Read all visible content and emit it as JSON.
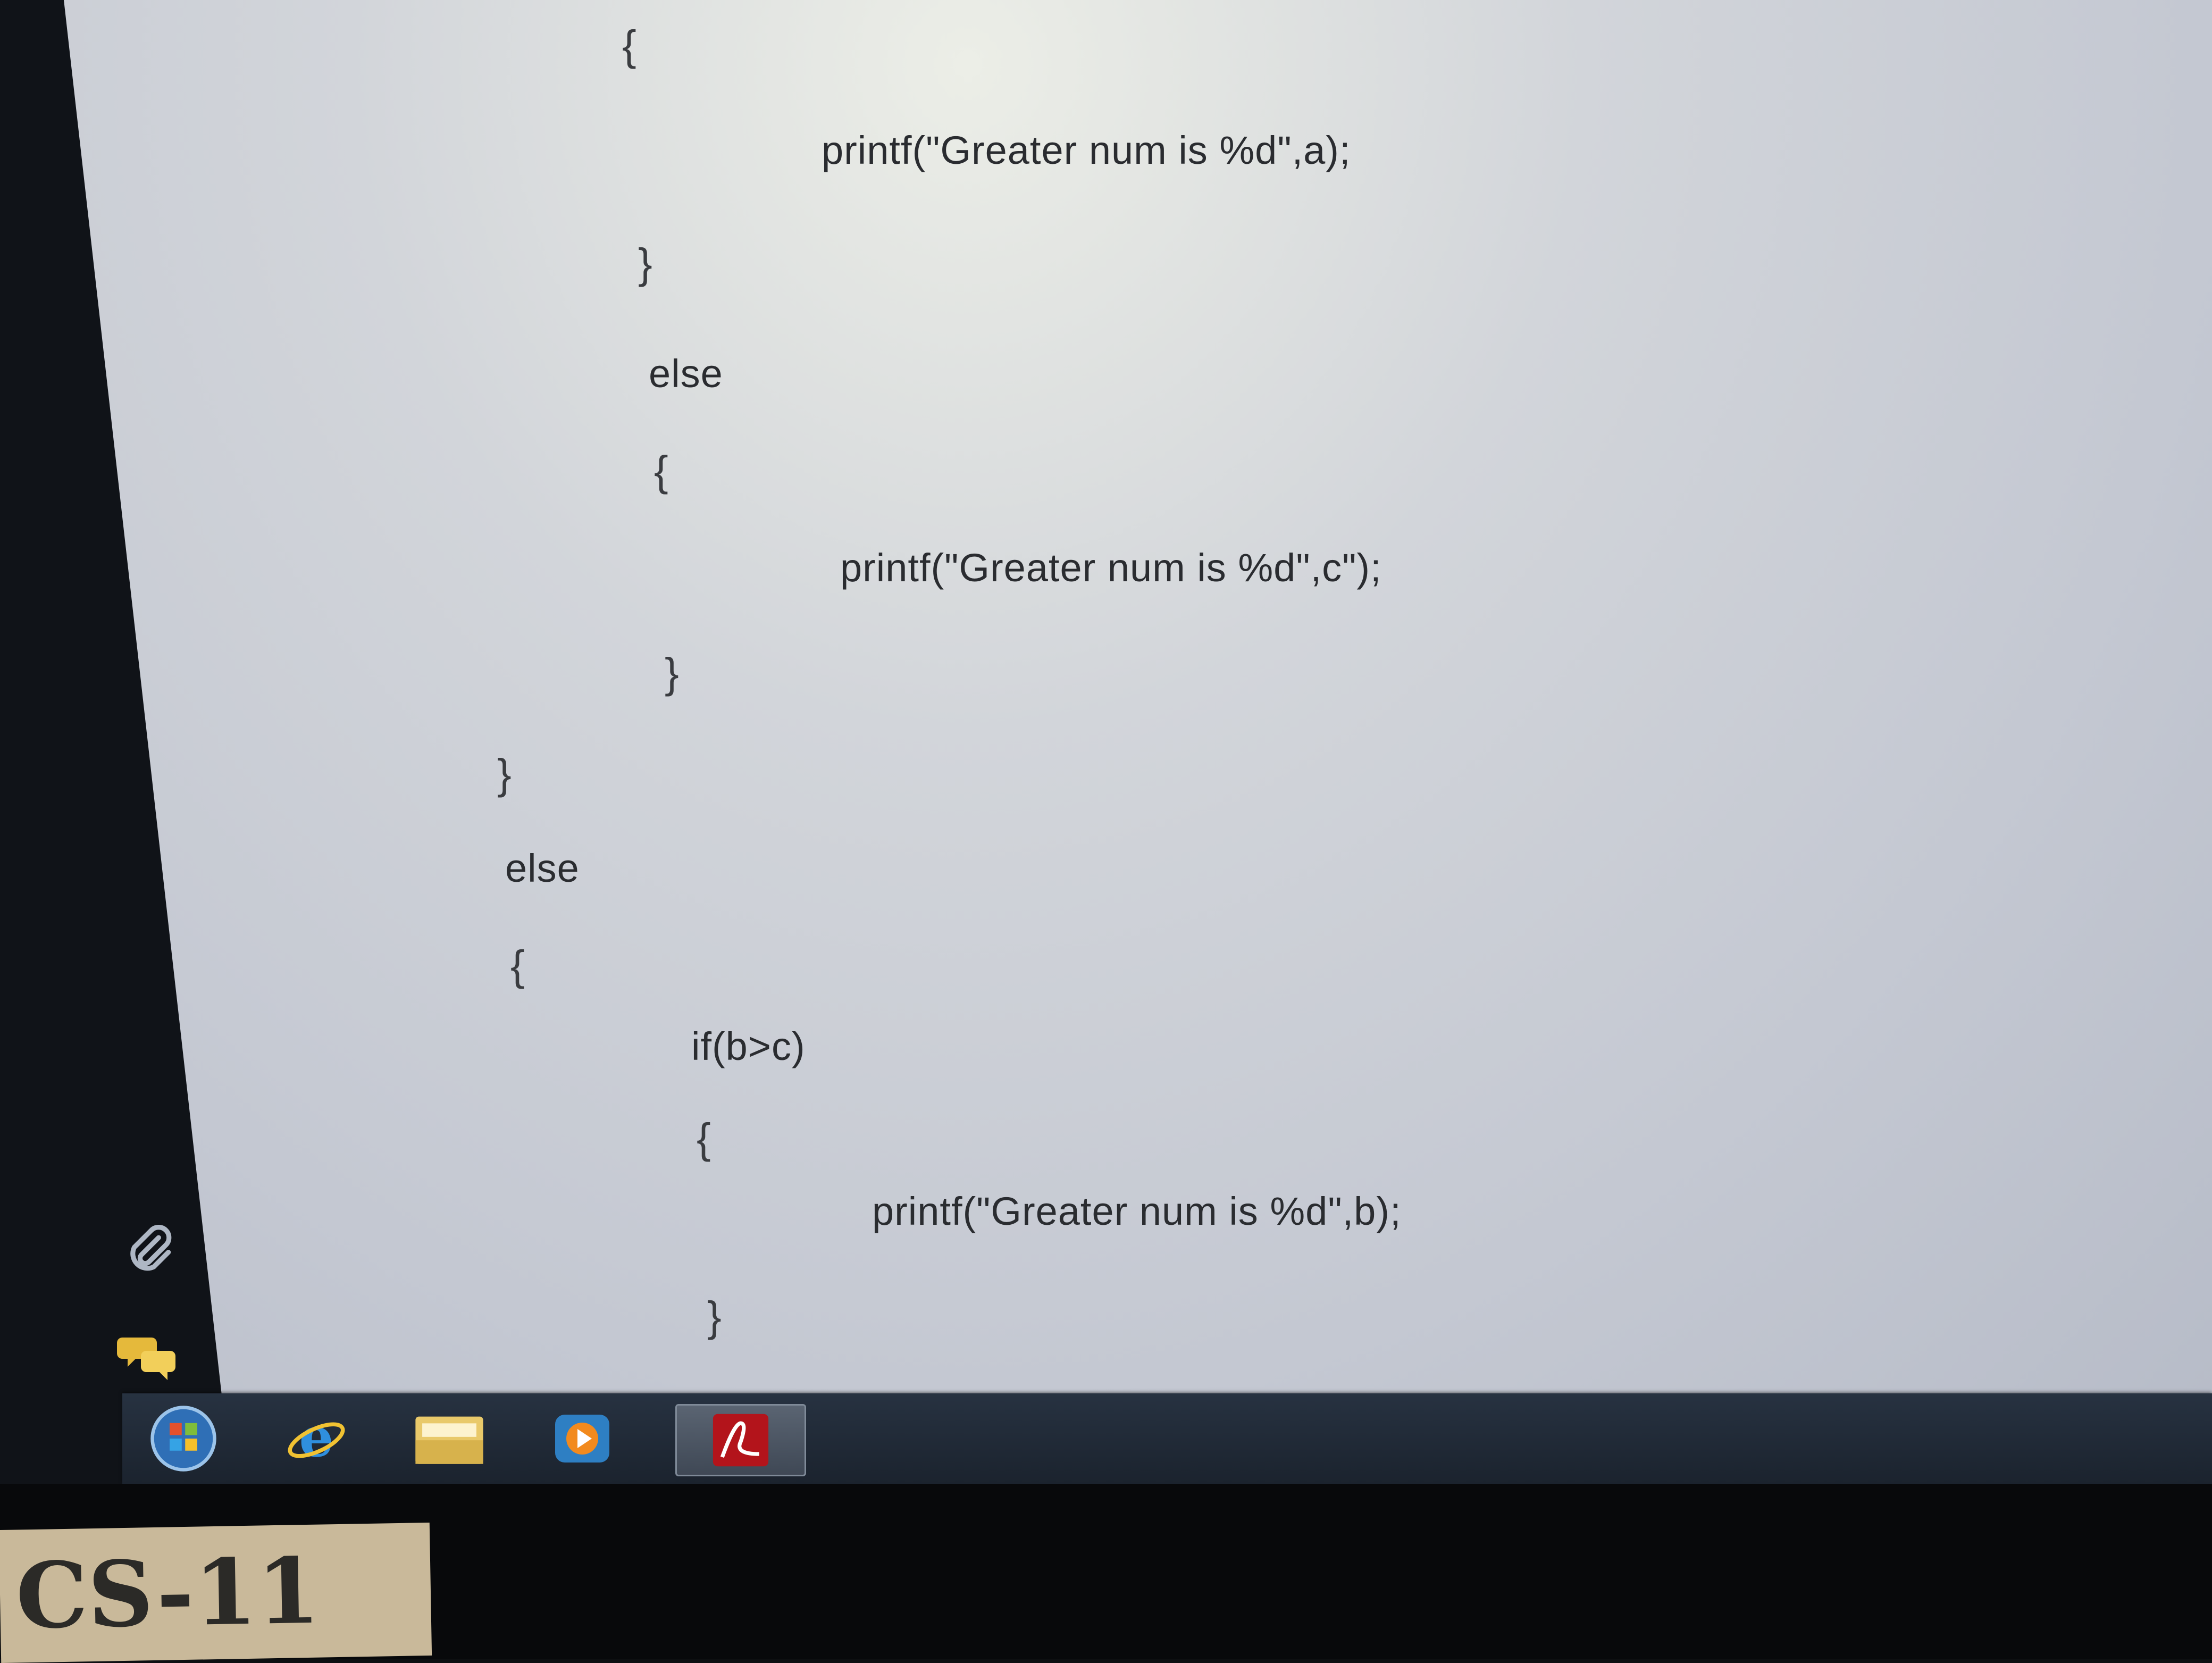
{
  "document": {
    "code_lines": [
      "{",
      "printf(\"Greater num is %d\",a);",
      "}",
      "else",
      "{",
      "printf(\"Greater num is %d\",c\");",
      "}",
      "}",
      "else",
      "{",
      "if(b>c)",
      "{",
      "printf(\"Greater num is %d\",b);",
      "}"
    ]
  },
  "side_tools": [
    {
      "icon": "paperclip-icon"
    },
    {
      "icon": "chat-icon"
    }
  ],
  "taskbar": {
    "items": [
      {
        "icon": "start-orb-icon"
      },
      {
        "icon": "internet-explorer-icon"
      },
      {
        "icon": "file-explorer-icon"
      },
      {
        "icon": "media-player-icon"
      },
      {
        "icon": "adobe-reader-icon",
        "active": true
      }
    ]
  },
  "desk_label": "CS-11",
  "monitor_brand": "",
  "colors": {
    "taskbar": "#1f2833",
    "document_bg": "#c8ccd5",
    "text": "#2a2c30",
    "label_card": "#c9b99a"
  }
}
